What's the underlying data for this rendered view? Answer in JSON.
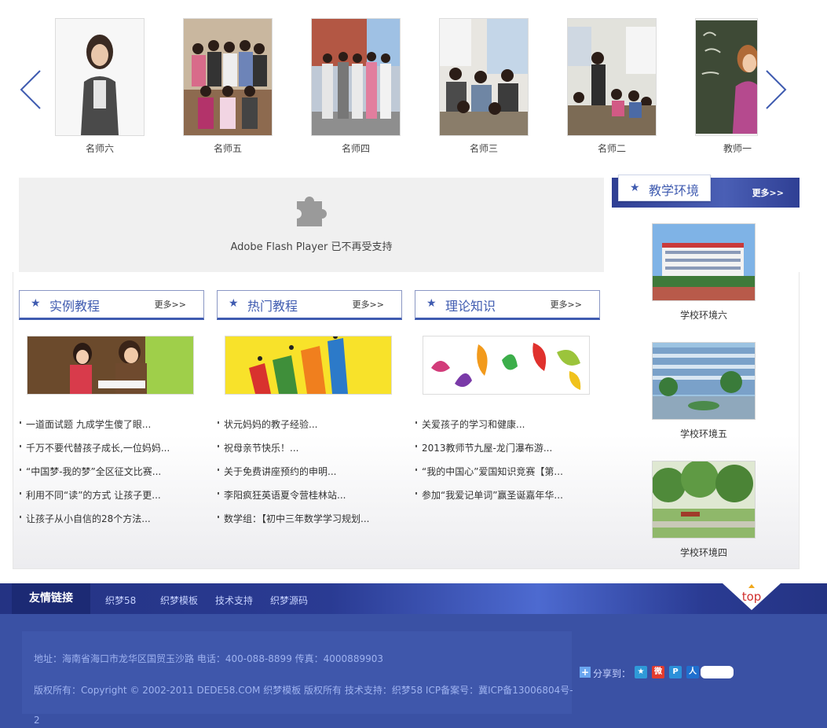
{
  "teachers": [
    {
      "name": "名师六"
    },
    {
      "name": "名师五"
    },
    {
      "name": "名师四"
    },
    {
      "name": "名师三"
    },
    {
      "name": "名师二"
    },
    {
      "name": "教师一"
    }
  ],
  "flash": {
    "message": "Adobe Flash Player 已不再受支持"
  },
  "sections": [
    {
      "title": "实例教程",
      "more": "更多>>",
      "items": [
        "一道面试题 九成学生傻了眼...",
        "千万不要代替孩子成长,一位妈妈...",
        "“中国梦-我的梦”全区征文比赛...",
        "利用不同“读”的方式 让孩子更...",
        "让孩子从小自信的28个方法..."
      ]
    },
    {
      "title": "热门教程",
      "more": "更多>>",
      "items": [
        "状元妈妈的教子经验...",
        "祝母亲节快乐！...",
        "关于免费讲座预约的申明...",
        "李阳疯狂英语夏令营桂林站...",
        "数学组：【初中三年数学学习规划..."
      ]
    },
    {
      "title": "理论知识",
      "more": "更多>>",
      "items": [
        "关爱孩子的学习和健康...",
        "2013教师节九屋-龙门瀑布游...",
        "“我的中国心”爱国知识竞赛【第...",
        "参加“我爱记单词”赢圣诞嘉年华..."
      ]
    }
  ],
  "environment": {
    "title": "教学环境",
    "more": "更多>>",
    "items": [
      {
        "name": "学校环境六"
      },
      {
        "name": "学校环境五"
      },
      {
        "name": "学校环境四"
      }
    ]
  },
  "links": {
    "title": "友情链接",
    "items": [
      "织梦58",
      "织梦模板",
      "技术支持",
      "织梦源码"
    ]
  },
  "top_label": "top",
  "footer": {
    "address": "地址：海南省海口市龙华区国贸玉沙路    电话：400-088-8899    传真：4000889903",
    "copyright": "版权所有：Copyright © 2002-2011 DEDE58.COM 织梦模板 版权所有    技术支持：织梦58    ICP备案号：冀ICP备13006804号-",
    "copyright_tail": "2",
    "share_label": "分享到："
  },
  "colors": {
    "accent": "#3f5bb0",
    "footer_bg": "#3a51a4",
    "link_bar": "#2a3b93"
  }
}
